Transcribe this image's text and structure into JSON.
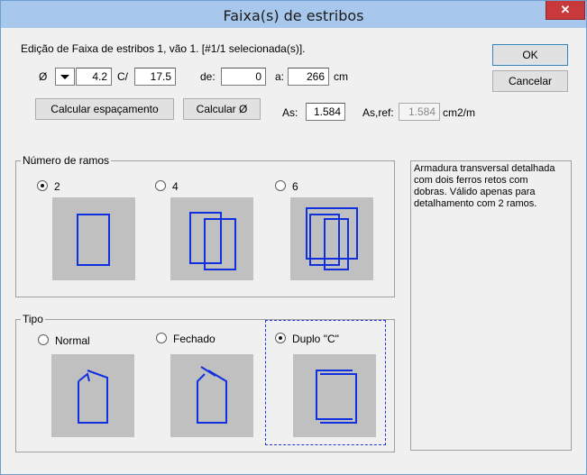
{
  "window": {
    "title": "Faixa(s) de estribos",
    "close_label": "✕"
  },
  "header": {
    "status": "Edição de Faixa de estribos 1, vão 1.  [#1/1 selecionada(s)]."
  },
  "row1": {
    "diameter_symbol": "Ø",
    "diameter_value": "4.2",
    "spacing_label": "C/",
    "spacing_value": "17.5",
    "from_label": "de:",
    "from_value": "0",
    "to_label": "a:",
    "to_value": "266",
    "unit_cm": "cm"
  },
  "row2": {
    "calc_spacing_label": "Calcular espaçamento",
    "calc_diameter_label": "Calcular Ø",
    "as_label": "As:",
    "as_value": "1.584",
    "asref_label": "As,ref:",
    "asref_value": "1.584",
    "unit_cm2m": "cm2/m"
  },
  "buttons": {
    "ok": "OK",
    "cancel": "Cancelar"
  },
  "ramos": {
    "title": "Número de ramos",
    "options": [
      {
        "label": "2",
        "selected": true
      },
      {
        "label": "4",
        "selected": false
      },
      {
        "label": "6",
        "selected": false
      }
    ]
  },
  "tipo": {
    "title": "Tipo",
    "options": [
      {
        "label": "Normal",
        "selected": false
      },
      {
        "label": "Fechado",
        "selected": false
      },
      {
        "label": "Duplo \"C\"",
        "selected": true
      }
    ]
  },
  "info": {
    "text": "Armadura transversal detalhada\ncom dois ferros retos com\ndobras. Válido apenas para\ndetalhamento com 2 ramos."
  },
  "colors": {
    "stirrup": "#1030e0",
    "preview_bg": "#c0c0c0",
    "titlebar": "#a7c8ec",
    "close": "#c7393a"
  },
  "icons": {
    "close": "close-icon",
    "dropdown": "chevron-down-icon"
  }
}
